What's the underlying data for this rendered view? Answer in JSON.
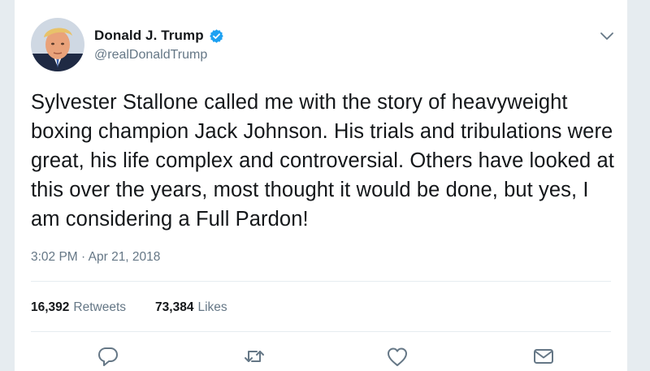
{
  "tweet": {
    "display_name": "Donald J. Trump",
    "handle": "@realDonaldTrump",
    "verified_icon": "verified-badge-icon",
    "text": "Sylvester Stallone called me with the story of heavyweight boxing champion Jack Johnson. His trials and tribulations were great, his life complex and controversial. Others have looked at this over the years, most thought it would be done, but yes, I am considering a Full Pardon!",
    "timestamp": "3:02 PM · Apr 21, 2018",
    "stats": {
      "retweets_count": "16,392",
      "retweets_label": "Retweets",
      "likes_count": "73,384",
      "likes_label": "Likes"
    }
  },
  "actions": [
    {
      "icon": "reply-icon"
    },
    {
      "icon": "retweet-icon"
    },
    {
      "icon": "like-icon"
    },
    {
      "icon": "direct-message-icon"
    }
  ],
  "colors": {
    "text_primary": "#14171a",
    "text_secondary": "#657786",
    "verified_blue": "#1da1f2",
    "divider": "#e6ecf0",
    "background": "#e6ecf0",
    "card": "#ffffff"
  }
}
